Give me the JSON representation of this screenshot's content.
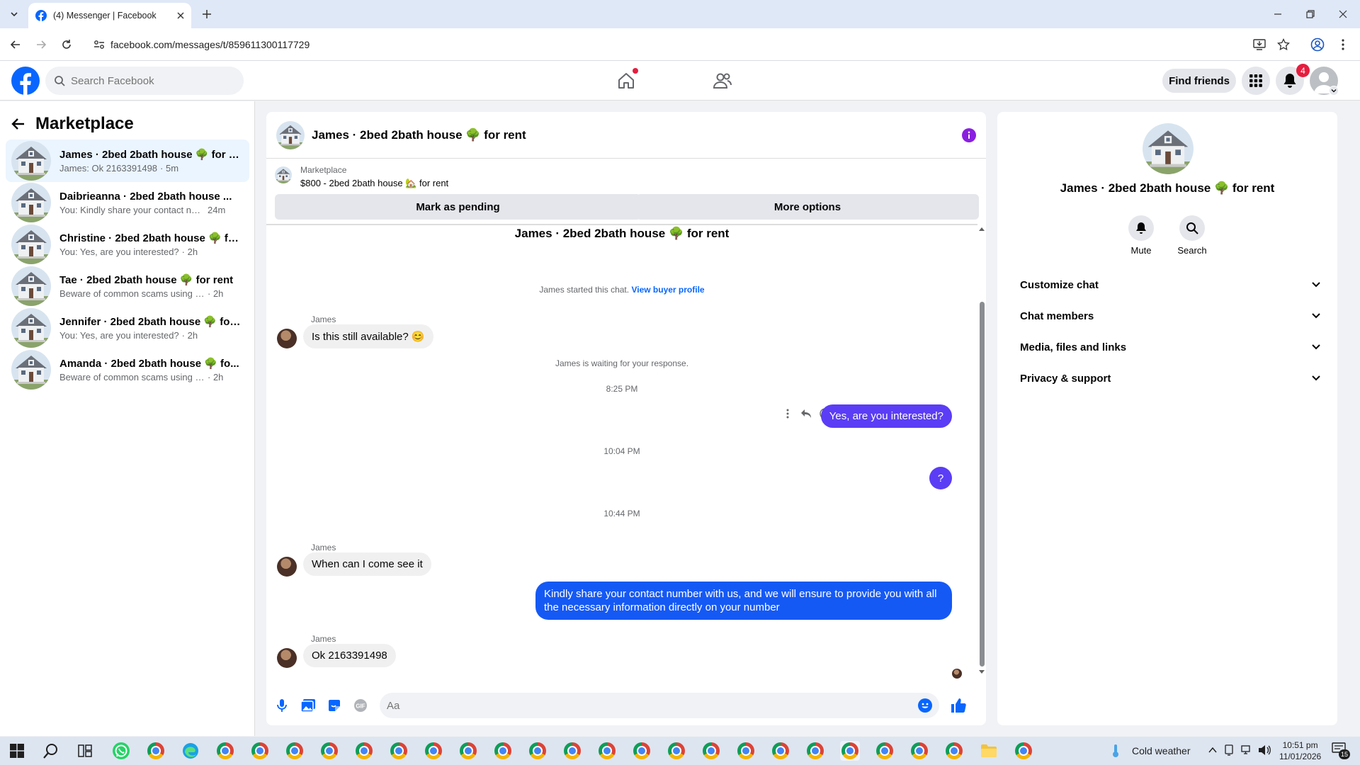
{
  "browser": {
    "tab_title": "(4) Messenger | Facebook",
    "url": "facebook.com/messages/t/859611300117729"
  },
  "facebook": {
    "search_placeholder": "Search Facebook",
    "find_friends": "Find friends",
    "notification_count": "4"
  },
  "sidebar": {
    "title": "Marketplace",
    "conversations": [
      {
        "name": "James · 2bed 2bath house 🌳 for r...",
        "snippet": "James: Ok 2163391498",
        "time": "· 5m",
        "active": true
      },
      {
        "name": "Daibrieanna · 2bed 2bath house ...",
        "snippet": "You: Kindly share your contact num...",
        "time": "24m"
      },
      {
        "name": "Christine · 2bed 2bath house 🌳 fo...",
        "snippet": "You: Yes, are you interested?",
        "time": "· 2h"
      },
      {
        "name": "Tae · 2bed 2bath house 🌳 for rent",
        "snippet": "Beware of common scams using pay...",
        "time": "· 2h"
      },
      {
        "name": "Jennifer · 2bed 2bath house 🌳 for...",
        "snippet": "You: Yes, are you interested?",
        "time": "· 2h"
      },
      {
        "name": "Amanda · 2bed 2bath house 🌳 fo...",
        "snippet": "Beware of common scams using pay...",
        "time": "· 2h"
      }
    ]
  },
  "chat": {
    "title": "James · 2bed 2bath house 🌳 for rent",
    "listing_label": "Marketplace",
    "listing_price": "$800 - 2bed 2bath house 🏡 for rent",
    "mark_pending": "Mark as pending",
    "more_options": "More options",
    "thread_title": "James · 2bed 2bath house 🌳 for rent",
    "started_text": "James started this chat.",
    "view_profile": "View buyer profile",
    "waiting_text": "James is waiting for your response.",
    "sender": "James",
    "msg1": "Is this still available? 😊",
    "time1": "8:25 PM",
    "out1": "Yes, are you interested?",
    "time2": "10:04 PM",
    "out2": "?",
    "time3": "10:44 PM",
    "msg2": "When can I come see it",
    "out3": "Kindly share your contact number with us, and we will ensure to provide you with all the necessary information directly on your number",
    "msg3": "Ok 2163391498",
    "input_placeholder": "Aa"
  },
  "info": {
    "name": "James · 2bed 2bath house 🌳 for rent",
    "mute": "Mute",
    "search": "Search",
    "sections": [
      "Customize chat",
      "Chat members",
      "Media, files and links",
      "Privacy & support"
    ]
  },
  "taskbar": {
    "weather": "Cold weather",
    "time": "10:51 pm",
    "date": "11/01/2026",
    "notif_count": "15"
  },
  "colors": {
    "fb_blue": "#0866ff",
    "message_purple": "#5b3df5",
    "message_blue": "#1559f5",
    "accent_purple": "#8a1fe0"
  }
}
